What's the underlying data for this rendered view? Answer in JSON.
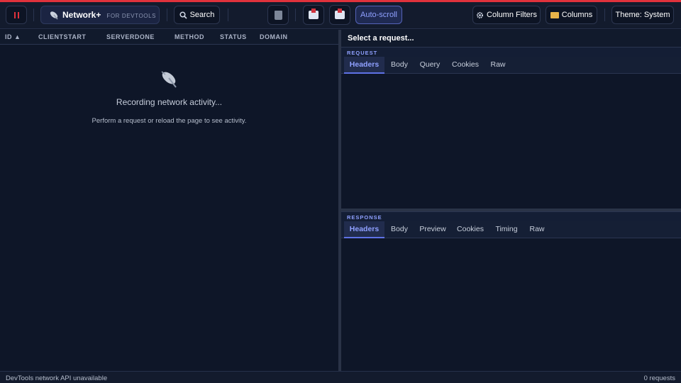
{
  "toolbar": {
    "brand_name": "Network+",
    "brand_sub": "FOR DEVTOOLS",
    "search_label": "Search",
    "autoscroll_label": "Auto-scroll",
    "column_filters_label": "Column Filters",
    "columns_label": "Columns",
    "theme_label": "Theme: System"
  },
  "table": {
    "columns": [
      "ID ▲",
      "CLIENTSTART",
      "SERVERDONE",
      "METHOD",
      "STATUS",
      "DOMAIN"
    ]
  },
  "empty_state": {
    "title": "Recording network activity...",
    "subtitle": "Perform a request or reload the page to see activity."
  },
  "detail": {
    "title": "Select a request...",
    "request": {
      "label": "REQUEST",
      "tabs": [
        "Headers",
        "Body",
        "Query",
        "Cookies",
        "Raw"
      ],
      "active": "Headers"
    },
    "response": {
      "label": "RESPONSE",
      "tabs": [
        "Headers",
        "Body",
        "Preview",
        "Cookies",
        "Timing",
        "Raw"
      ],
      "active": "Headers"
    }
  },
  "status": {
    "message": "DevTools network API unavailable",
    "count": "0 requests"
  },
  "colors": {
    "accent": "#8fa0ff",
    "recording_red": "#e0323c",
    "background": "#0e1628"
  }
}
